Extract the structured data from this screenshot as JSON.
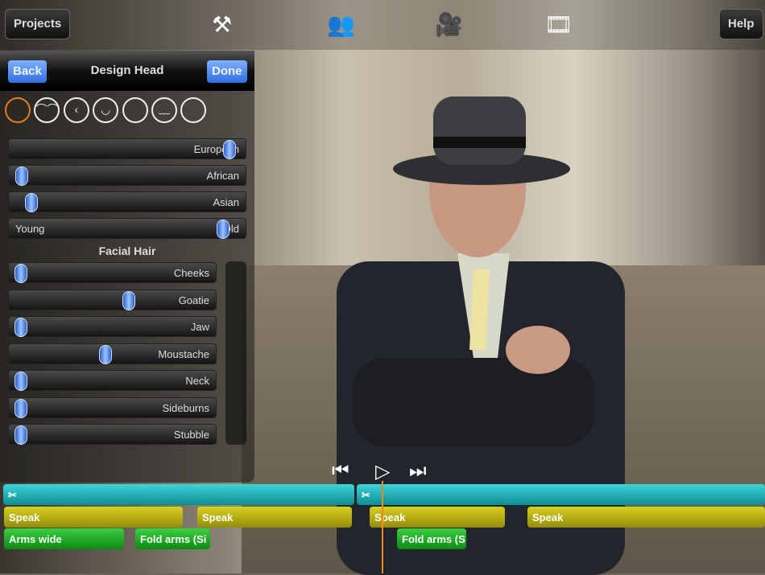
{
  "topbar": {
    "projects": "Projects",
    "help": "Help",
    "icons": [
      "tools-icon",
      "characters-icon",
      "camera-icon",
      "export-video-icon"
    ]
  },
  "panel": {
    "back": "Back",
    "title": "Design Head",
    "done": "Done",
    "face_shapes": [
      "round",
      "brows",
      "cheek",
      "smile",
      "chin",
      "moustache",
      "jaw"
    ],
    "ethnicity": [
      {
        "label": "European",
        "value": 0.95
      },
      {
        "label": "African",
        "value": 0.03
      },
      {
        "label": "Asian",
        "value": 0.07
      }
    ],
    "age": {
      "left": "Young",
      "right": "Old",
      "value": 0.92
    },
    "facial_hair_title": "Facial Hair",
    "facial_hair": [
      {
        "label": "Cheeks",
        "value": 0.03
      },
      {
        "label": "Goatie",
        "value": 0.58
      },
      {
        "label": "Jaw",
        "value": 0.03
      },
      {
        "label": "Moustache",
        "value": 0.46
      },
      {
        "label": "Neck",
        "value": 0.03
      },
      {
        "label": "Sideburns",
        "value": 0.03
      },
      {
        "label": "Stubble",
        "value": 0.03
      }
    ]
  },
  "timeline": {
    "speak": [
      "Speak",
      "Speak",
      "Speak",
      "Speak"
    ],
    "actions": [
      "Arms wide",
      "Fold arms (Si",
      "Fold arms (S"
    ]
  },
  "colors": {
    "accent": "#e87a1a",
    "button": "#3d7ef0",
    "scene_track": "#1fb3b8",
    "speak_track": "#c0b814",
    "action_track": "#22b026"
  }
}
